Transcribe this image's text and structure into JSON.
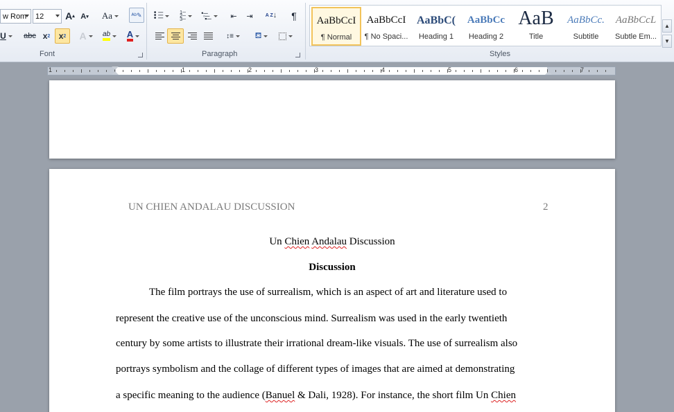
{
  "ribbon": {
    "font": {
      "group_label": "Font",
      "font_name": "w Rom",
      "font_size": "12",
      "grow_label": "A",
      "shrink_label": "A",
      "change_case_label": "Aa",
      "underline_label": "U",
      "strike_label": "abc",
      "subscript_label": "x",
      "superscript_label": "x",
      "subscript_mark": "2",
      "superscript_mark": "2",
      "effects_label": "A",
      "highlight_label": "ab",
      "font_color_label": "A",
      "highlight_color": "#ffff00",
      "font_color": "#e02020"
    },
    "paragraph": {
      "group_label": "Paragraph",
      "sort_label": "A Z",
      "pilcrow": "¶"
    },
    "styles": {
      "group_label": "Styles",
      "items": [
        {
          "sample": "AaBbCcI",
          "name": "¶ Normal"
        },
        {
          "sample": "AaBbCcI",
          "name": "¶ No Spaci..."
        },
        {
          "sample": "AaBbC(",
          "name": "Heading 1"
        },
        {
          "sample": "AaBbCc",
          "name": "Heading 2"
        },
        {
          "sample": "AaB",
          "name": "Title"
        },
        {
          "sample": "AaBbCc.",
          "name": "Subtitle"
        },
        {
          "sample": "AaBbCcL",
          "name": "Subtle Em..."
        }
      ]
    }
  },
  "ruler": {
    "numbers": [
      "1",
      "1",
      "2",
      "3",
      "4",
      "5",
      "6",
      "7"
    ]
  },
  "document": {
    "header_title": "UN CHIEN ANDALAU DISCUSSION",
    "page_number": "2",
    "title_pre": "Un ",
    "title_w1": "Chien",
    "title_space": " ",
    "title_w2": "Andalau",
    "title_post": " Discussion",
    "heading": "Discussion",
    "line1": "The film portrays the use of surrealism,  which is an aspect of art and literature used to",
    "line2": "represent the creative use of the unconscious mind. Surrealism  was used in the early twentieth",
    "line3": "century by some artists to illustrate their irrational  dream-like visuals. The use of surrealism  also",
    "line4": "portrays symbolism  and the collage  of different types of images that are aimed at demonstrating",
    "line5_pre": "a specific meaning to the audience (",
    "line5_cite": "Banuel",
    "line5_mid": " & Dali, 1928). For instance, the short film Un ",
    "line5_end": "Chien"
  }
}
